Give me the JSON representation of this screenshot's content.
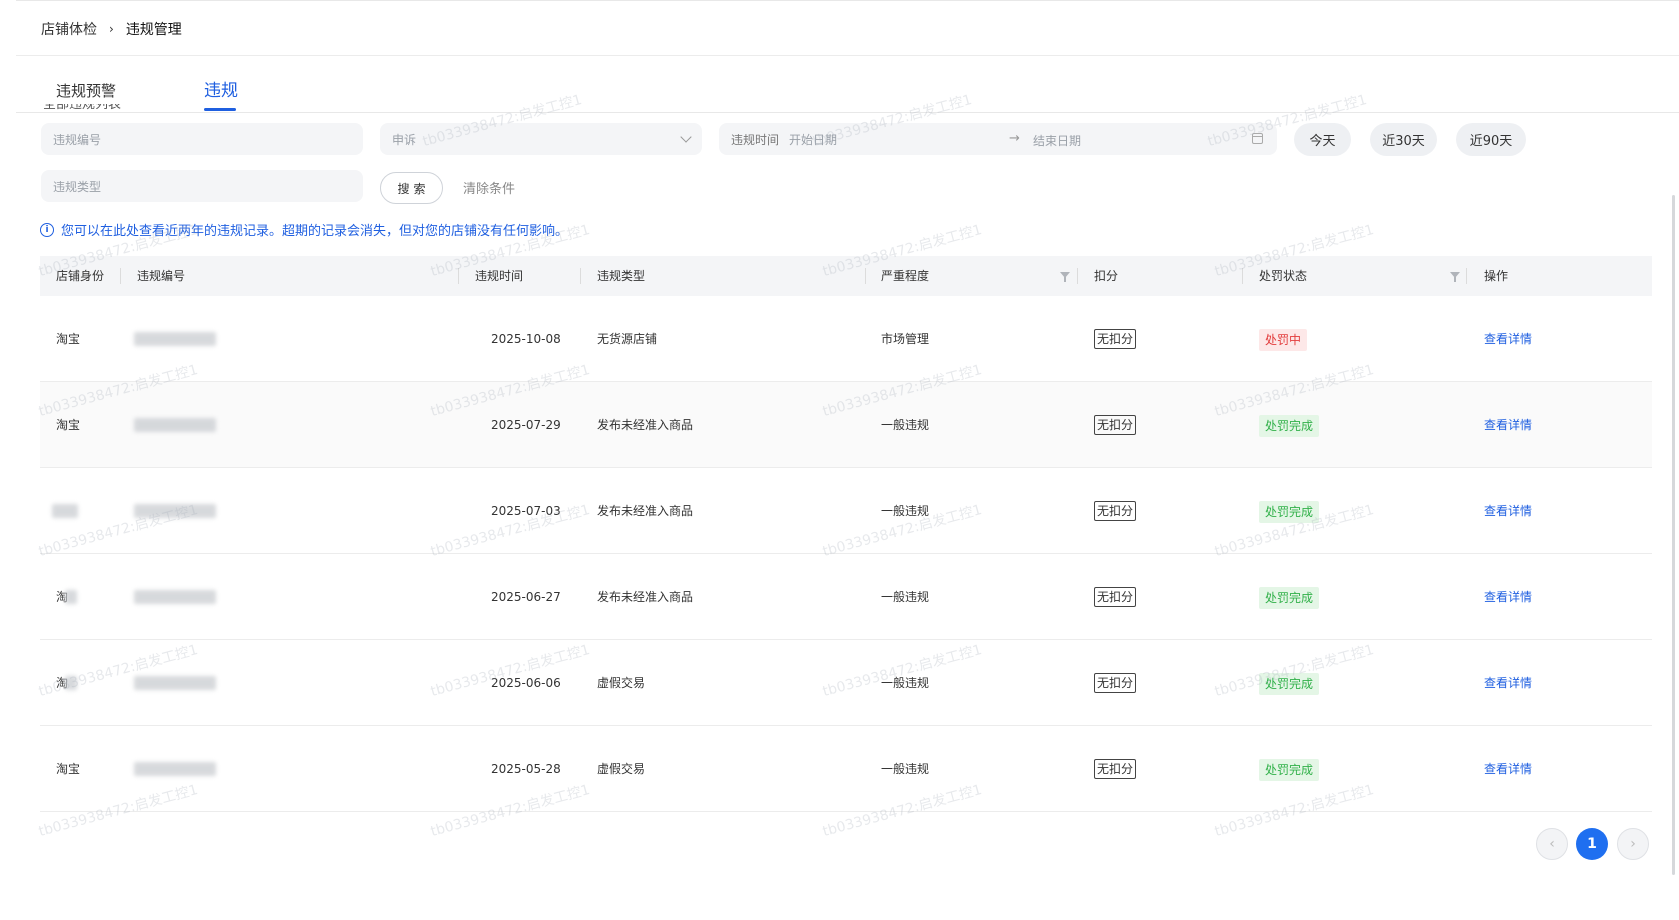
{
  "breadcrumb": {
    "parent": "店铺体检",
    "separator": "›",
    "current": "违规管理"
  },
  "tabs": [
    {
      "label": "违规预警"
    },
    {
      "label": "违规"
    }
  ],
  "section_heading": "全部违规列表",
  "filters": {
    "id_placeholder": "违规编号",
    "appeal_placeholder": "申诉",
    "time_label": "违规时间",
    "start_placeholder": "开始日期",
    "end_placeholder": "结束日期",
    "type_placeholder": "违规类型",
    "quick_today": "今天",
    "quick_30": "近30天",
    "quick_90": "近90天",
    "search_label": "搜索",
    "clear_label": "清除条件"
  },
  "notice": "您可以在此处查看近两年的违规记录。超期的记录会消失，但对您的店铺没有任何影响。",
  "table": {
    "columns": [
      "店铺身份",
      "违规编号",
      "违规时间",
      "违规类型",
      "严重程度",
      "扣分",
      "处罚状态",
      "操作"
    ],
    "rows": [
      {
        "shop": "淘宝",
        "date": "2025-10-08",
        "type": "无货源店铺",
        "severity": "市场管理",
        "points": "无扣分",
        "status": "处罚中",
        "status_kind": "red",
        "action": "查看详情"
      },
      {
        "shop": "淘宝",
        "date": "2025-07-29",
        "type": "发布未经准入商品",
        "severity": "一般违规",
        "points": "无扣分",
        "status": "处罚完成",
        "status_kind": "green",
        "action": "查看详情"
      },
      {
        "shop": "",
        "date": "2025-07-03",
        "type": "发布未经准入商品",
        "severity": "一般违规",
        "points": "无扣分",
        "status": "处罚完成",
        "status_kind": "green",
        "action": "查看详情"
      },
      {
        "shop": "淘",
        "date": "2025-06-27",
        "type": "发布未经准入商品",
        "severity": "一般违规",
        "points": "无扣分",
        "status": "处罚完成",
        "status_kind": "green",
        "action": "查看详情"
      },
      {
        "shop": "淘",
        "date": "2025-06-06",
        "type": "虚假交易",
        "severity": "一般违规",
        "points": "无扣分",
        "status": "处罚完成",
        "status_kind": "green",
        "action": "查看详情"
      },
      {
        "shop": "淘宝",
        "date": "2025-05-28",
        "type": "虚假交易",
        "severity": "一般违规",
        "points": "无扣分",
        "status": "处罚完成",
        "status_kind": "green",
        "action": "查看详情"
      }
    ]
  },
  "pagination": {
    "prev": "‹",
    "current": "1",
    "next": "›"
  },
  "watermark_text": "tb033938472:启发工控1",
  "colors": {
    "accent": "#1f5fe0",
    "danger": "#e23c3c",
    "success": "#32b14a"
  }
}
